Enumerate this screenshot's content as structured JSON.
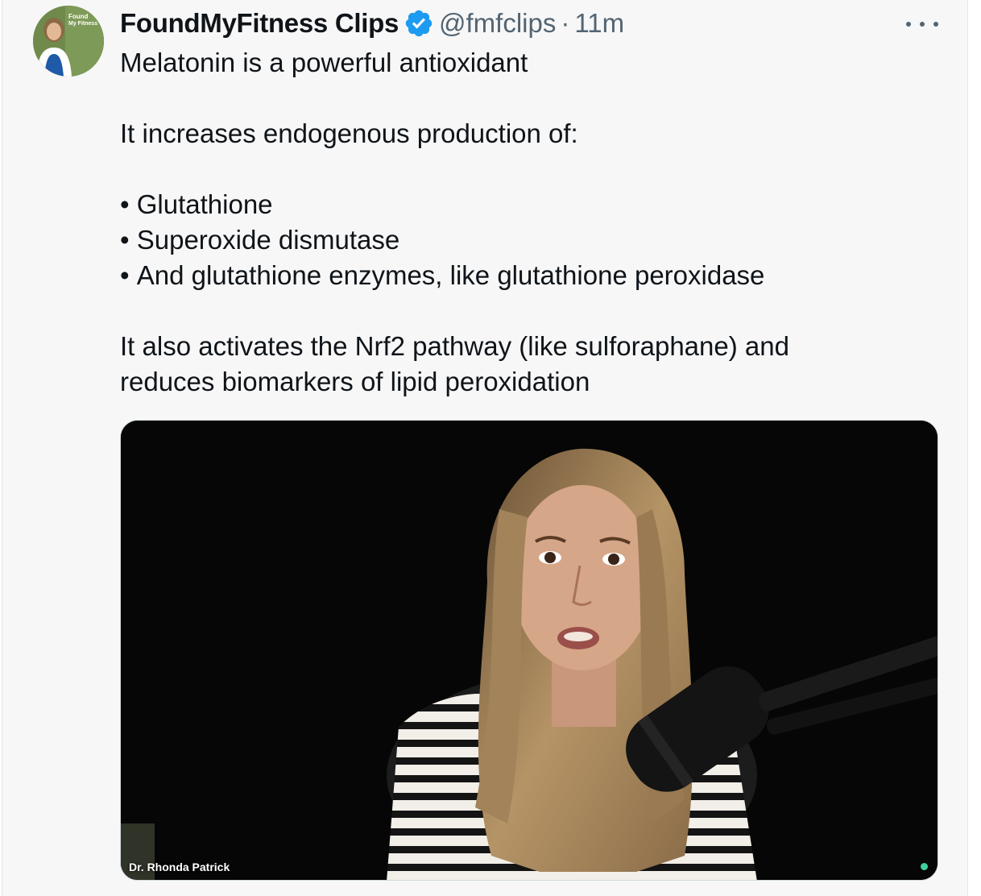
{
  "tweet": {
    "display_name": "FoundMyFitness Clips",
    "handle": "@fmfclips",
    "separator": "·",
    "time": "11m",
    "avatar": {
      "label_line1": "Found",
      "label_line2": "My Fitness"
    },
    "icons": {
      "verified": "verified-badge-icon",
      "more": "more-options-icon"
    },
    "colors": {
      "verified": "#1d9bf0",
      "secondary_text": "#536471"
    },
    "body": {
      "line1": "Melatonin is a powerful antioxidant",
      "line2": "It increases endogenous production of:",
      "bullets": [
        "Glutathione",
        "Superoxide dismutase",
        "And glutathione enzymes, like glutathione peroxidase"
      ],
      "line3a": "It also activates the Nrf2 pathway (like sulforaphane) and",
      "line3b": "reduces biomarkers of lipid peroxidation"
    },
    "media": {
      "caption": "Dr. Rhonda Patrick"
    }
  }
}
